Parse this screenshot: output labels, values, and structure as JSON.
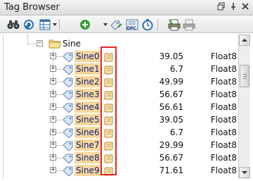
{
  "window": {
    "title": "Tag Browser",
    "controls": [
      "restore-icon",
      "pin-icon",
      "close-icon"
    ]
  },
  "toolbar": {
    "buttons": [
      "binoculars-icon",
      "refresh-icon",
      "table-layout-icon",
      "add-tag-icon",
      "edit-tag-icon",
      "opc-icon",
      "clock-icon",
      "print-icon",
      "printer-icon"
    ],
    "opc_label": "OPC"
  },
  "tree": {
    "folder": {
      "label": "Sine"
    },
    "tags": [
      {
        "name": "Sine0",
        "value": "39.05",
        "type": "Float8"
      },
      {
        "name": "Sine1",
        "value": "6.7",
        "type": "Float8"
      },
      {
        "name": "Sine2",
        "value": "49.99",
        "type": "Float8"
      },
      {
        "name": "Sine3",
        "value": "56.67",
        "type": "Float8"
      },
      {
        "name": "Sine4",
        "value": "56.61",
        "type": "Float8"
      },
      {
        "name": "Sine5",
        "value": "39.05",
        "type": "Float8"
      },
      {
        "name": "Sine6",
        "value": "6.7",
        "type": "Float8"
      },
      {
        "name": "Sine7",
        "value": "29.99",
        "type": "Float8"
      },
      {
        "name": "Sine8",
        "value": "56.67",
        "type": "Float8"
      },
      {
        "name": "Sine9",
        "value": "71.61",
        "type": "Float8"
      }
    ]
  },
  "colors": {
    "selection_highlight": "#f7d79a",
    "annotation_box": "#e02828",
    "tag_text": "#102080"
  }
}
